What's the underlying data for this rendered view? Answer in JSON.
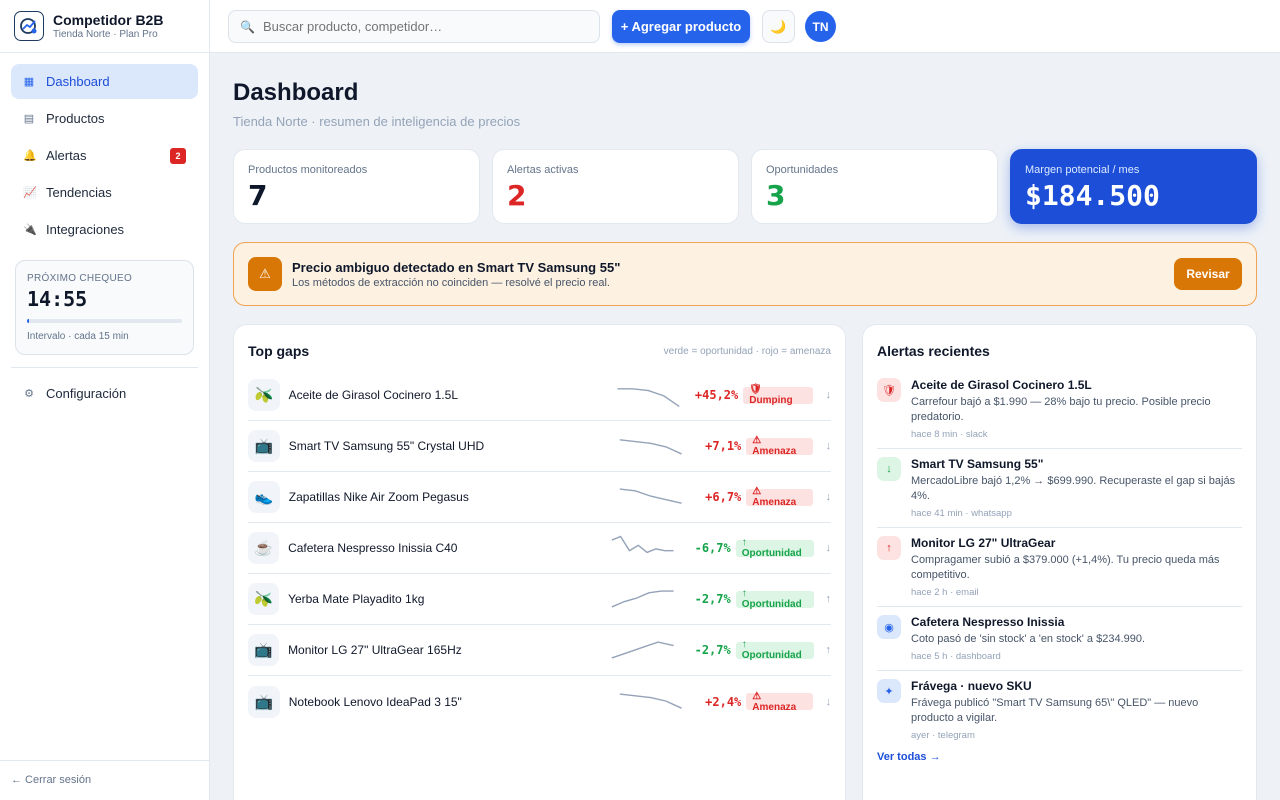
{
  "brand": {
    "name": "Competidor B2B",
    "sub": "Tienda Norte · Plan Pro"
  },
  "nav": [
    {
      "label": "Dashboard",
      "icon": "▦",
      "icon_name": "grid-icon"
    },
    {
      "label": "Productos",
      "icon": "▤",
      "icon_name": "box-icon"
    },
    {
      "label": "Alertas",
      "icon": "🔔",
      "icon_name": "bell-icon",
      "badge": "2"
    },
    {
      "label": "Tendencias",
      "icon": "📈",
      "icon_name": "chart-icon"
    },
    {
      "label": "Integraciones",
      "icon": "🔌",
      "icon_name": "plug-icon"
    }
  ],
  "next_check": {
    "label": "PRÓXIMO CHEQUEO",
    "time": "14:55",
    "progress": 0.01,
    "interval": "Intervalo · cada 15 min"
  },
  "settings_label": "Configuración",
  "logout_label": "← Cerrar sesión",
  "topbar": {
    "search_placeholder": "Buscar producto, competidor…",
    "add_label": "+ Agregar producto",
    "theme_icon": "🌙",
    "avatar": "TN"
  },
  "page": {
    "title": "Dashboard",
    "subtitle": "Tienda Norte · resumen de inteligencia de precios"
  },
  "stats": [
    {
      "label": "Productos monitoreados",
      "value": "7",
      "color": "#0f172a"
    },
    {
      "label": "Alertas activas",
      "value": "2",
      "color": "#dc2626"
    },
    {
      "label": "Oportunidades",
      "value": "3",
      "color": "#16a34a"
    },
    {
      "label": "Margen potencial / mes",
      "value": "$184.500",
      "color": "#ffffff"
    }
  ],
  "banner": {
    "title": "Precio ambiguo detectado en Smart TV Samsung 55\"",
    "text": "Los métodos de extracción no coinciden — resolvé el precio real.",
    "button": "Revisar"
  },
  "gaps": {
    "title": "Top gaps",
    "legend": "verde = oportunidad · rojo = amenaza",
    "rows": [
      {
        "icon": "🫒",
        "name": "Aceite de Girasol Cocinero 1.5L",
        "value": "+45,2%",
        "tone": "red",
        "tag": "🛡 Dumping",
        "arrow": "↓",
        "trend": [
          10,
          10,
          12,
          18,
          30
        ]
      },
      {
        "icon": "📺",
        "name": "Smart TV Samsung 55\" Crystal UHD",
        "value": "+7,1%",
        "tone": "red",
        "tag": "⚠ Amenaza",
        "arrow": "↓",
        "trend": [
          10,
          12,
          14,
          18,
          26
        ]
      },
      {
        "icon": "👟",
        "name": "Zapatillas Nike Air Zoom Pegasus",
        "value": "+6,7%",
        "tone": "red",
        "tag": "⚠ Amenaza",
        "arrow": "↓",
        "trend": [
          8,
          10,
          16,
          20,
          24
        ]
      },
      {
        "icon": "☕",
        "name": "Cafetera Nespresso Inissia C40",
        "value": "-6,7%",
        "tone": "green",
        "tag": "↑ Oportunidad",
        "arrow": "↓",
        "trend": [
          8,
          4,
          20,
          14,
          22,
          18,
          20,
          20
        ]
      },
      {
        "icon": "🫒",
        "name": "Yerba Mate Playadito 1kg",
        "value": "-2,7%",
        "tone": "green",
        "tag": "↑ Oportunidad",
        "arrow": "↑",
        "trend": [
          26,
          20,
          16,
          10,
          8,
          8
        ]
      },
      {
        "icon": "📺",
        "name": "Monitor LG 27\" UltraGear 165Hz",
        "value": "-2,7%",
        "tone": "green",
        "tag": "↑ Oportunidad",
        "arrow": "↑",
        "trend": [
          26,
          20,
          14,
          8,
          12
        ]
      },
      {
        "icon": "📺",
        "name": "Notebook Lenovo IdeaPad 3 15\"",
        "value": "+2,4%",
        "tone": "red",
        "tag": "⚠ Amenaza",
        "arrow": "↓",
        "trend": [
          8,
          10,
          12,
          16,
          24
        ]
      }
    ]
  },
  "recent": {
    "title": "Alertas recientes",
    "items": [
      {
        "icon": "🛡",
        "tone": "red",
        "title": "Aceite de Girasol Cocinero 1.5L",
        "text": "Carrefour bajó a $1.990 — 28% bajo tu precio. Posible precio predatorio.",
        "meta": "hace 8 min · slack"
      },
      {
        "icon": "↓",
        "tone": "green",
        "title": "Smart TV Samsung 55\"",
        "text": "MercadoLibre bajó 1,2% → $699.990. Recuperaste el gap si bajás 4%.",
        "meta": "hace 41 min · whatsapp"
      },
      {
        "icon": "↑",
        "tone": "red",
        "title": "Monitor LG 27\" UltraGear",
        "text": "Compragamer subió a $379.000 (+1,4%). Tu precio queda más competitivo.",
        "meta": "hace 2 h · email"
      },
      {
        "icon": "◉",
        "tone": "blue",
        "title": "Cafetera Nespresso Inissia",
        "text": "Coto pasó de 'sin stock' a 'en stock' a $234.990.",
        "meta": "hace 5 h · dashboard"
      },
      {
        "icon": "✦",
        "tone": "blue",
        "title": "Frávega · nuevo SKU",
        "text": "Frávega publicó \"Smart TV Samsung 65\\\" QLED\" — nuevo producto a vigilar.",
        "meta": "ayer · telegram"
      }
    ],
    "see_all": "Ver todas →"
  }
}
